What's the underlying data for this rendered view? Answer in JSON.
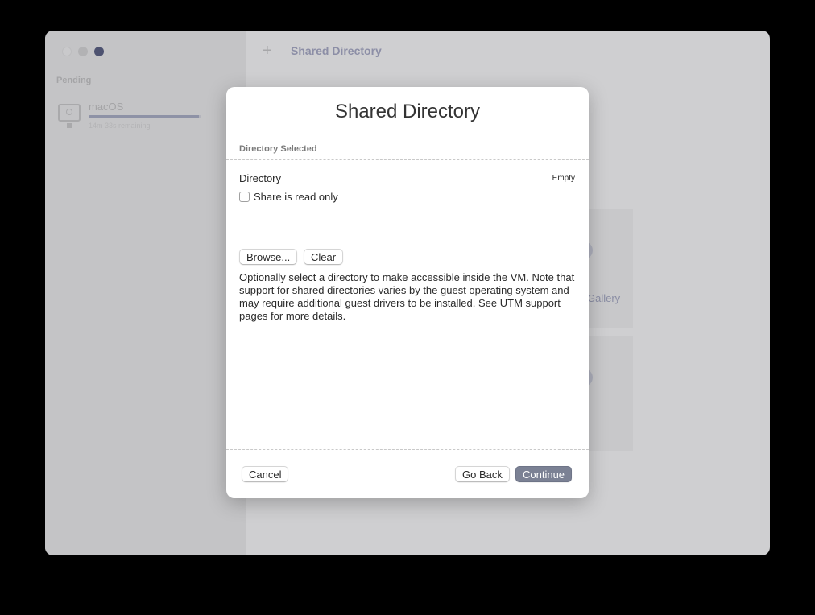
{
  "window": {
    "title": "Shared Directory",
    "add_icon": "plus-icon",
    "accent_color": "#7b8194"
  },
  "sidebar": {
    "section_label": "Pending",
    "items": [
      {
        "name": "macOS",
        "remaining": "14m 33s remaining",
        "progress_fraction": 0.98,
        "icon": "monitor-icon"
      }
    ]
  },
  "background_content": {
    "gallery_text": "Gallery"
  },
  "modal": {
    "title": "Shared Directory",
    "section_header": "Directory Selected",
    "directory_label": "Directory",
    "directory_value": "Empty",
    "readonly_label": "Share is read only",
    "readonly_checked": false,
    "browse_label": "Browse...",
    "clear_label": "Clear",
    "description": "Optionally select a directory to make accessible inside the VM. Note that support for shared directories varies by the guest operating system and may require additional guest drivers to be installed. See UTM support pages for more details.",
    "cancel_label": "Cancel",
    "go_back_label": "Go Back",
    "continue_label": "Continue"
  }
}
